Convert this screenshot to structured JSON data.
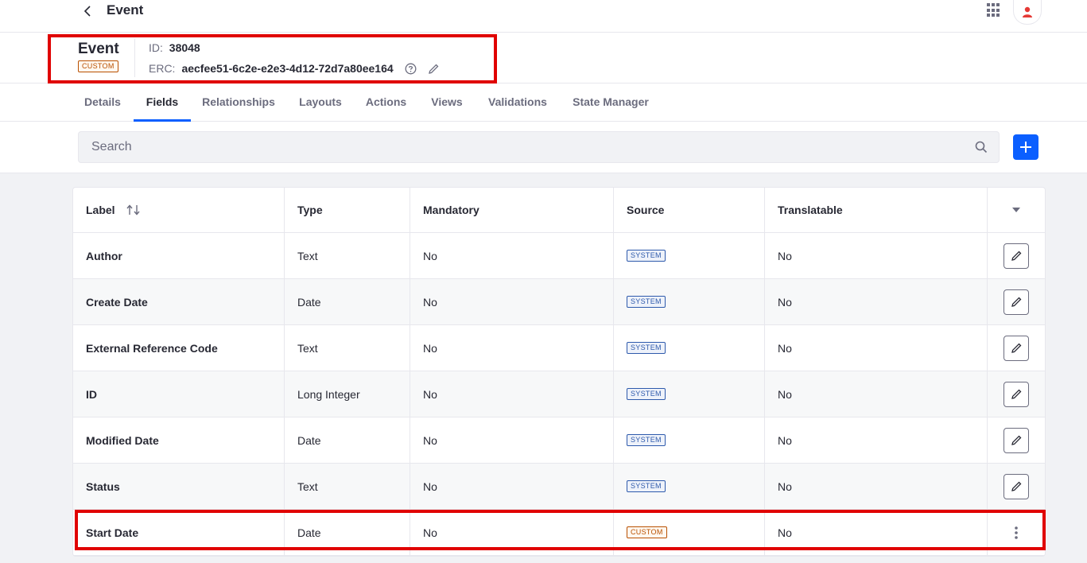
{
  "topbar": {
    "title": "Event"
  },
  "object": {
    "name": "Event",
    "badge": "CUSTOM",
    "id_label": "ID:",
    "id_value": "38048",
    "erc_label": "ERC:",
    "erc_value": "aecfee51-6c2e-e2e3-4d12-72d7a80ee164"
  },
  "tabs": [
    {
      "label": "Details"
    },
    {
      "label": "Fields",
      "active": true
    },
    {
      "label": "Relationships"
    },
    {
      "label": "Layouts"
    },
    {
      "label": "Actions"
    },
    {
      "label": "Views"
    },
    {
      "label": "Validations"
    },
    {
      "label": "State Manager"
    }
  ],
  "search": {
    "placeholder": "Search"
  },
  "table": {
    "columns": [
      "Label",
      "Type",
      "Mandatory",
      "Source",
      "Translatable"
    ],
    "rows": [
      {
        "label": "Author",
        "type": "Text",
        "mandatory": "No",
        "source": "SYSTEM",
        "translatable": "No"
      },
      {
        "label": "Create Date",
        "type": "Date",
        "mandatory": "No",
        "source": "SYSTEM",
        "translatable": "No"
      },
      {
        "label": "External Reference Code",
        "type": "Text",
        "mandatory": "No",
        "source": "SYSTEM",
        "translatable": "No"
      },
      {
        "label": "ID",
        "type": "Long Integer",
        "mandatory": "No",
        "source": "SYSTEM",
        "translatable": "No"
      },
      {
        "label": "Modified Date",
        "type": "Date",
        "mandatory": "No",
        "source": "SYSTEM",
        "translatable": "No"
      },
      {
        "label": "Status",
        "type": "Text",
        "mandatory": "No",
        "source": "SYSTEM",
        "translatable": "No"
      },
      {
        "label": "Start Date",
        "type": "Date",
        "mandatory": "No",
        "source": "CUSTOM",
        "translatable": "No"
      }
    ]
  },
  "colors": {
    "accent": "#0b5fff",
    "highlight": "#e00000",
    "custom": "#b95000",
    "system": "#2e5aac"
  },
  "icons": [
    "chevron-left-icon",
    "apps-grid-icon",
    "user-icon",
    "help-icon",
    "pencil-icon",
    "search-icon",
    "plus-icon",
    "sort-icon",
    "caret-down-icon",
    "kebab-icon"
  ]
}
